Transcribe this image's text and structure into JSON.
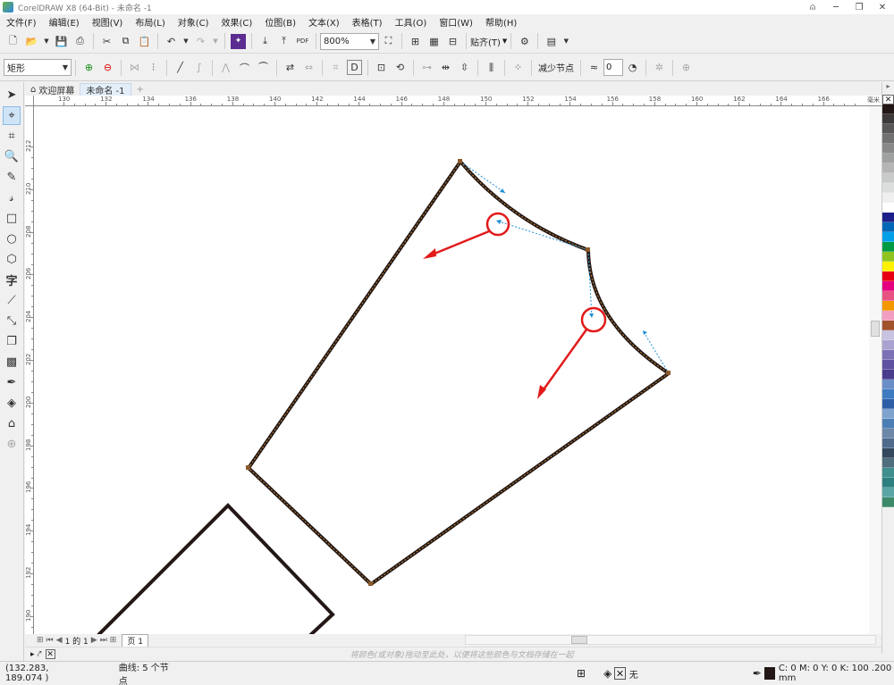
{
  "window": {
    "title": "CorelDRAW X8 (64-Bit) - 未命名 -1"
  },
  "menu": [
    "文件(F)",
    "编辑(E)",
    "视图(V)",
    "布局(L)",
    "对象(C)",
    "效果(C)",
    "位图(B)",
    "文本(X)",
    "表格(T)",
    "工具(O)",
    "窗口(W)",
    "帮助(H)"
  ],
  "toolbar": {
    "zoom_value": "800%",
    "snap_label": "贴齐(T)",
    "pdf_label": "PDF"
  },
  "property_bar": {
    "shape_type": "矩形",
    "reduce_nodes_label": "减少节点",
    "smooth_value": "0"
  },
  "tabs": [
    {
      "label": "欢迎屏幕"
    },
    {
      "label": "未命名 -1"
    }
  ],
  "ruler": {
    "h_labels": [
      "130",
      "132",
      "134",
      "136",
      "138",
      "140",
      "142",
      "144",
      "146",
      "148",
      "150",
      "152",
      "154",
      "156",
      "158",
      "160",
      "162",
      "164",
      "166"
    ],
    "v_labels": [
      "212",
      "210",
      "208",
      "206",
      "204",
      "202",
      "200",
      "198",
      "196",
      "194",
      "192",
      "190"
    ],
    "unit": "毫米"
  },
  "page_nav": {
    "page_of": "1 的 1",
    "page_tab": "页 1"
  },
  "color_tray_hint": "将颜色(或对象)拖动至此处，以便将这些颜色与文档存储在一起",
  "status": {
    "coords": "(132.283, 189.074 )",
    "object_info": "曲线: 5 个节点",
    "fill_label": "无",
    "outline_info": "C: 0 M: 0 Y: 0 K: 100  .200 mm"
  },
  "palette_colors": [
    "#231815",
    "#3e3a39",
    "#595757",
    "#727171",
    "#898989",
    "#9fa0a0",
    "#b5b5b6",
    "#c9caca",
    "#dcdddd",
    "#efefef",
    "#ffffff",
    "#1d2088",
    "#0068b7",
    "#00a0e9",
    "#009944",
    "#8fc31f",
    "#fff100",
    "#e60012",
    "#e4007f",
    "#e95383",
    "#f39800",
    "#f19ec2",
    "#a0522d",
    "#c8c3e1",
    "#aaa3d1",
    "#7d71b6",
    "#5f52a0",
    "#4a3c8c",
    "#6a8fc7",
    "#3e7bc0",
    "#2e5fa6",
    "#7fa3cf",
    "#4d7fb5",
    "#6d87a8",
    "#506a8c",
    "#34495e",
    "#4f6f7f",
    "#3f8f8f",
    "#2e7f7f",
    "#5aa5a5",
    "#3d8a6a"
  ]
}
